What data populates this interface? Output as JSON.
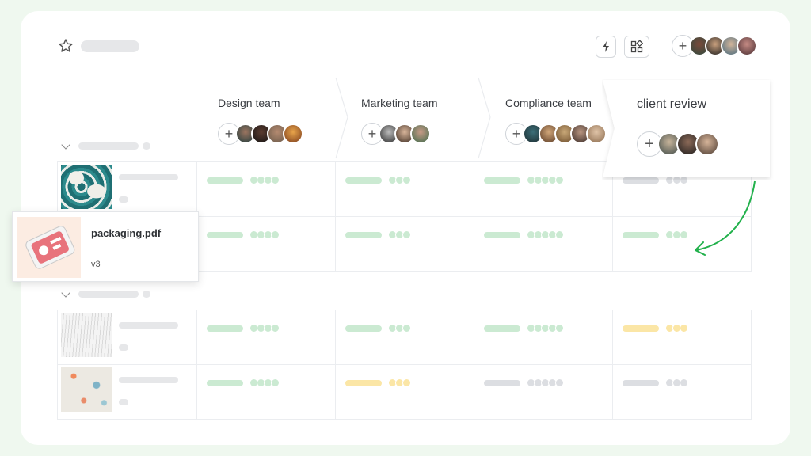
{
  "stages": [
    {
      "title": "Design team"
    },
    {
      "title": "Marketing team"
    },
    {
      "title": "Compliance team"
    },
    {
      "title": "client review"
    }
  ],
  "file_card": {
    "name": "packaging.pdf",
    "version": "v3"
  },
  "toolbar": {
    "add_symbol": "+"
  },
  "colors": {
    "accent_green": "#22b14c",
    "done": "#cbead2",
    "pending": "#fbe6a6",
    "not_started": "#dcdee2"
  },
  "icons": [
    "star-icon",
    "lightning-icon",
    "apps-icon",
    "chevron-down-icon",
    "plus-icon"
  ]
}
